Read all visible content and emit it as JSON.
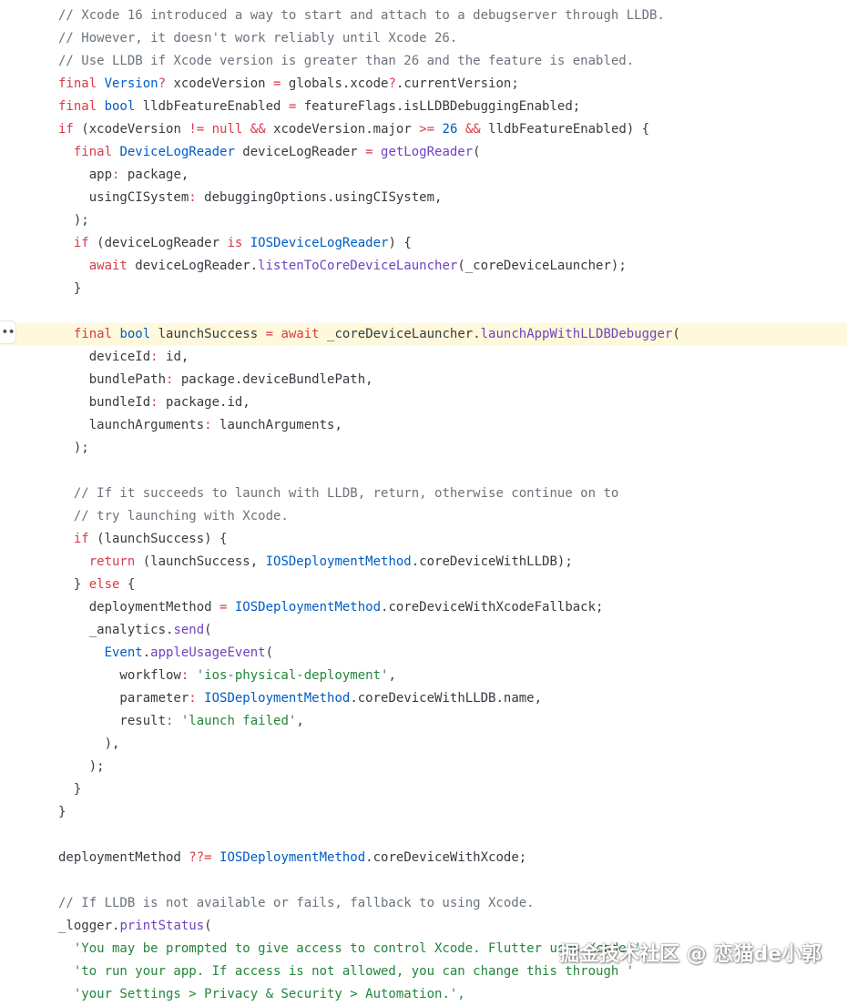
{
  "colors": {
    "background": "#ffffff",
    "highlight_line": "#fff9db",
    "comment": "#6a737d",
    "keyword": "#d73a49",
    "type": "#005cc5",
    "function": "#6f42c1",
    "string": "#22863a",
    "plain": "#383a42"
  },
  "gutter": {
    "more_icon": "ellipsis-icon",
    "more_glyph": "••"
  },
  "highlighted_line_index": 14,
  "code_lines": [
    [
      [
        "cm",
        "// Xcode 16 introduced a way to start and attach to a debugserver through LLDB."
      ]
    ],
    [
      [
        "cm",
        "// However, it doesn't work reliably until Xcode 26."
      ]
    ],
    [
      [
        "cm",
        "// Use LLDB if Xcode version is greater than 26 and the feature is enabled."
      ]
    ],
    [
      [
        "kw",
        "final "
      ],
      [
        "ty",
        "Version"
      ],
      [
        "op",
        "? "
      ],
      [
        "ne",
        "xcodeVersion "
      ],
      [
        "op",
        "= "
      ],
      [
        "ne",
        "globals.xcode"
      ],
      [
        "op",
        "?"
      ],
      [
        "ne",
        ".currentVersion;"
      ]
    ],
    [
      [
        "kw",
        "final "
      ],
      [
        "ty",
        "bool "
      ],
      [
        "ne",
        "lldbFeatureEnabled "
      ],
      [
        "op",
        "= "
      ],
      [
        "ne",
        "featureFlags.isLLDBDebuggingEnabled;"
      ]
    ],
    [
      [
        "kw",
        "if "
      ],
      [
        "ne",
        "(xcodeVersion "
      ],
      [
        "op",
        "!= "
      ],
      [
        "kw",
        "null "
      ],
      [
        "op",
        "&& "
      ],
      [
        "ne",
        "xcodeVersion.major "
      ],
      [
        "op",
        ">= "
      ],
      [
        "nu",
        "26 "
      ],
      [
        "op",
        "&& "
      ],
      [
        "ne",
        "lldbFeatureEnabled) {"
      ]
    ],
    [
      [
        "ne",
        "  "
      ],
      [
        "kw",
        "final "
      ],
      [
        "ty",
        "DeviceLogReader "
      ],
      [
        "ne",
        "deviceLogReader "
      ],
      [
        "op",
        "= "
      ],
      [
        "fn",
        "getLogReader"
      ],
      [
        "ne",
        "("
      ]
    ],
    [
      [
        "ne",
        "    app"
      ],
      [
        "op",
        ": "
      ],
      [
        "ne",
        "package,"
      ]
    ],
    [
      [
        "ne",
        "    usingCISystem"
      ],
      [
        "op",
        ": "
      ],
      [
        "ne",
        "debuggingOptions.usingCISystem,"
      ]
    ],
    [
      [
        "ne",
        "  );"
      ]
    ],
    [
      [
        "ne",
        "  "
      ],
      [
        "kw",
        "if "
      ],
      [
        "ne",
        "(deviceLogReader "
      ],
      [
        "kw",
        "is "
      ],
      [
        "ty",
        "IOSDeviceLogReader"
      ],
      [
        "ne",
        ") {"
      ]
    ],
    [
      [
        "ne",
        "    "
      ],
      [
        "kw",
        "await "
      ],
      [
        "ne",
        "deviceLogReader."
      ],
      [
        "fn",
        "listenToCoreDeviceLauncher"
      ],
      [
        "ne",
        "(_coreDeviceLauncher);"
      ]
    ],
    [
      [
        "ne",
        "  }"
      ]
    ],
    [
      [
        "ne",
        ""
      ]
    ],
    [
      [
        "ne",
        "  "
      ],
      [
        "kw",
        "final "
      ],
      [
        "ty",
        "bool "
      ],
      [
        "ne",
        "launchSuccess "
      ],
      [
        "op",
        "= "
      ],
      [
        "kw",
        "await "
      ],
      [
        "ne",
        "_coreDeviceLauncher."
      ],
      [
        "fn",
        "launchAppWithLLDBDebugger"
      ],
      [
        "ne",
        "("
      ]
    ],
    [
      [
        "ne",
        "    deviceId"
      ],
      [
        "op",
        ": "
      ],
      [
        "ne",
        "id,"
      ]
    ],
    [
      [
        "ne",
        "    bundlePath"
      ],
      [
        "op",
        ": "
      ],
      [
        "ne",
        "package.deviceBundlePath,"
      ]
    ],
    [
      [
        "ne",
        "    bundleId"
      ],
      [
        "op",
        ": "
      ],
      [
        "ne",
        "package.id,"
      ]
    ],
    [
      [
        "ne",
        "    launchArguments"
      ],
      [
        "op",
        ": "
      ],
      [
        "ne",
        "launchArguments,"
      ]
    ],
    [
      [
        "ne",
        "  );"
      ]
    ],
    [
      [
        "ne",
        ""
      ]
    ],
    [
      [
        "ne",
        "  "
      ],
      [
        "cm",
        "// If it succeeds to launch with LLDB, return, otherwise continue on to"
      ]
    ],
    [
      [
        "ne",
        "  "
      ],
      [
        "cm",
        "// try launching with Xcode."
      ]
    ],
    [
      [
        "ne",
        "  "
      ],
      [
        "kw",
        "if "
      ],
      [
        "ne",
        "(launchSuccess) {"
      ]
    ],
    [
      [
        "ne",
        "    "
      ],
      [
        "kw",
        "return "
      ],
      [
        "ne",
        "(launchSuccess, "
      ],
      [
        "ty",
        "IOSDeploymentMethod"
      ],
      [
        "ne",
        ".coreDeviceWithLLDB);"
      ]
    ],
    [
      [
        "ne",
        "  } "
      ],
      [
        "kw",
        "else "
      ],
      [
        "ne",
        "{"
      ]
    ],
    [
      [
        "ne",
        "    deploymentMethod "
      ],
      [
        "op",
        "= "
      ],
      [
        "ty",
        "IOSDeploymentMethod"
      ],
      [
        "ne",
        ".coreDeviceWithXcodeFallback;"
      ]
    ],
    [
      [
        "ne",
        "    _analytics."
      ],
      [
        "fn",
        "send"
      ],
      [
        "ne",
        "("
      ]
    ],
    [
      [
        "ne",
        "      "
      ],
      [
        "ty",
        "Event"
      ],
      [
        "ne",
        "."
      ],
      [
        "fn",
        "appleUsageEvent"
      ],
      [
        "ne",
        "("
      ]
    ],
    [
      [
        "ne",
        "        workflow"
      ],
      [
        "op",
        ": "
      ],
      [
        "st",
        "'ios-physical-deployment'"
      ],
      [
        "ne",
        ","
      ]
    ],
    [
      [
        "ne",
        "        parameter"
      ],
      [
        "op",
        ": "
      ],
      [
        "ty",
        "IOSDeploymentMethod"
      ],
      [
        "ne",
        ".coreDeviceWithLLDB.name,"
      ]
    ],
    [
      [
        "ne",
        "        result"
      ],
      [
        "op",
        ": "
      ],
      [
        "st",
        "'launch failed'"
      ],
      [
        "ne",
        ","
      ]
    ],
    [
      [
        "ne",
        "      ),"
      ]
    ],
    [
      [
        "ne",
        "    );"
      ]
    ],
    [
      [
        "ne",
        "  }"
      ]
    ],
    [
      [
        "ne",
        "}"
      ]
    ],
    [
      [
        "ne",
        ""
      ]
    ],
    [
      [
        "ne",
        "deploymentMethod "
      ],
      [
        "op",
        "??= "
      ],
      [
        "ty",
        "IOSDeploymentMethod"
      ],
      [
        "ne",
        ".coreDeviceWithXcode;"
      ]
    ],
    [
      [
        "ne",
        ""
      ]
    ],
    [
      [
        "cm",
        "// If LLDB is not available or fails, fallback to using Xcode."
      ]
    ],
    [
      [
        "ne",
        "_logger."
      ],
      [
        "fn",
        "printStatus"
      ],
      [
        "ne",
        "("
      ]
    ],
    [
      [
        "ne",
        "  "
      ],
      [
        "st",
        "'You may be prompted to give access to control Xcode. Flutter uses Xcode '"
      ]
    ],
    [
      [
        "ne",
        "  "
      ],
      [
        "st",
        "'to run your app. If access is not allowed, you can change this through '"
      ]
    ],
    [
      [
        "ne",
        "  "
      ],
      [
        "st",
        "'your Settings > Privacy & Security > Automation.',"
      ]
    ]
  ],
  "watermark": {
    "text": "掘金技术社区 @ 恋猫de小郭"
  }
}
